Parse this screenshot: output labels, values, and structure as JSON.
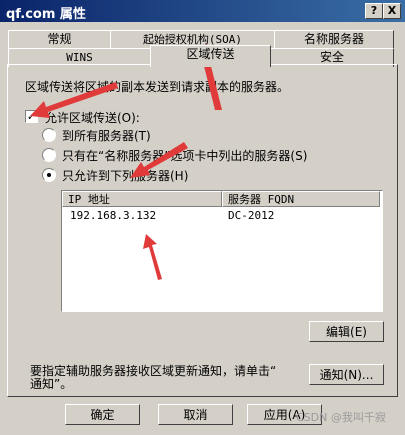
{
  "window": {
    "title": "qf.com 属性",
    "help": "?",
    "close": "X"
  },
  "tabs_row1": [
    "常规",
    "起始授权机构(SOA)",
    "名称服务器"
  ],
  "tabs_row2": [
    "WINS",
    "区域传送",
    "安全"
  ],
  "description": "区域传送将区域的副本发送到请求副本的服务器。",
  "allow_transfer": {
    "label": "允许区域传送(O):",
    "checked": true
  },
  "radio_options": [
    {
      "label": "到所有服务器(T)",
      "selected": false
    },
    {
      "label": "只有在“名称服务器”选项卡中列出的服务器(S)",
      "selected": false
    },
    {
      "label": "只允许到下列服务器(H)",
      "selected": true
    }
  ],
  "server_list": {
    "columns": [
      "IP 地址",
      "服务器 FQDN"
    ],
    "rows": [
      {
        "ip": "192.168.3.132",
        "fqdn": "DC-2012"
      }
    ]
  },
  "edit_button": "编辑(E)",
  "notify_text": {
    "line1": "要指定辅助服务器接收区域更新通知，请单击“",
    "line2": "通知”。"
  },
  "notify_button": "通知(N)...",
  "bottom_buttons": {
    "ok": "确定",
    "cancel": "取消",
    "apply": "应用(A)"
  },
  "watermark": "CSDN @我叫千寂",
  "colors": {
    "title_bar_start": "#0a246a",
    "title_bar_end": "#3a6ea5",
    "arrow": "#e03a3a"
  }
}
